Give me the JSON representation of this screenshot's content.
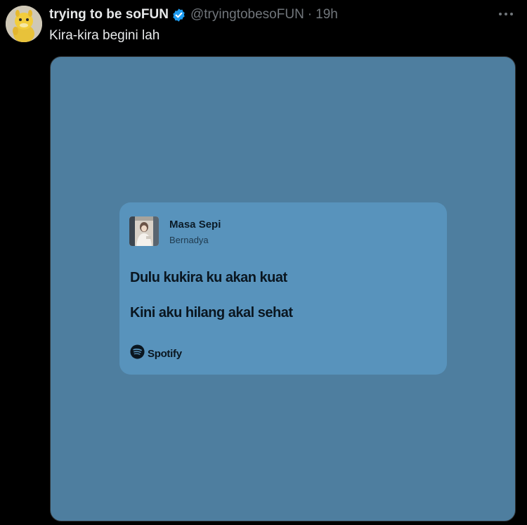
{
  "author": {
    "display_name": "trying to be soFUN",
    "handle": "@tryingtobesoFUN",
    "separator": "·",
    "time": "19h",
    "verified": true
  },
  "tweet": {
    "text": "Kira-kira begini lah"
  },
  "lyric_card": {
    "song_title": "Masa Sepi",
    "artist": "Bernadya",
    "lyrics": [
      "Dulu kukira ku akan kuat",
      "Kini aku hilang akal sehat"
    ],
    "brand": "Spotify"
  },
  "colors": {
    "background": "#000000",
    "media_background": "#4e7e9f",
    "card_background": "#5893bc",
    "verified_badge": "#1d9bf0",
    "primary_text": "#e7e9ea",
    "secondary_text": "#71767b"
  },
  "icons": {
    "verified": "verified-badge-icon",
    "more": "more-options-icon",
    "spotify": "spotify-logo-icon"
  }
}
